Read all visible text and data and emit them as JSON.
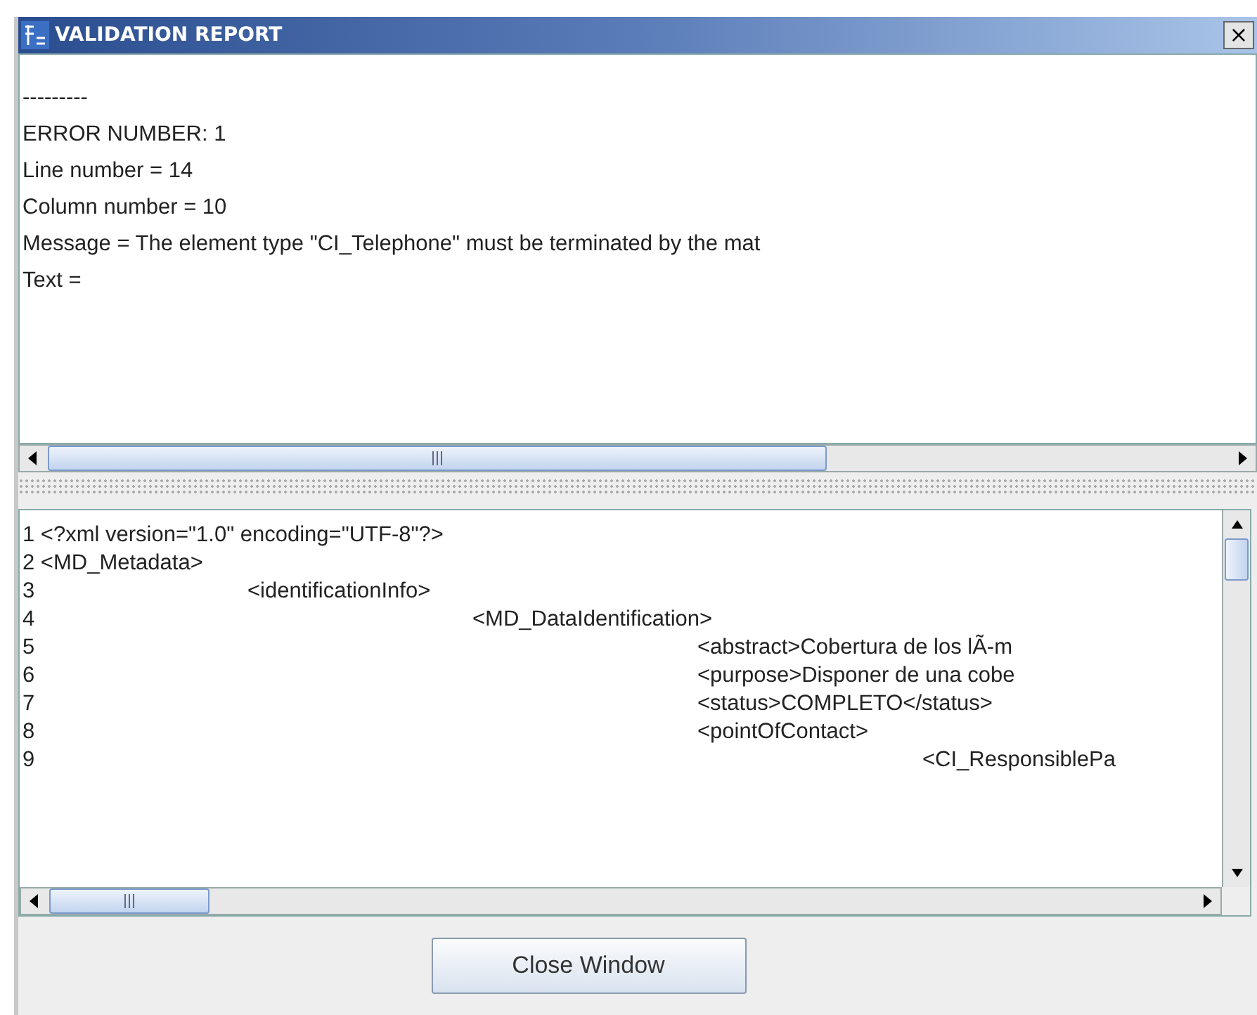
{
  "window": {
    "title": "VALIDATION REPORT",
    "close": "×"
  },
  "report": {
    "lines": [
      "---------",
      "ERROR NUMBER: 1",
      "Line number = 14",
      "Column number = 10",
      "Message = The element type \"CI_Telephone\" must be terminated by the mat",
      "Text ="
    ]
  },
  "source": {
    "lines": [
      "1 <?xml version=\"1.0\" encoding=\"UTF-8\"?>",
      "2 <MD_Metadata>",
      "3 \t<identificationInfo>",
      "4 \t\t<MD_DataIdentification>",
      "5 \t\t\t<abstract>Cobertura de los lÃ-m",
      "6 \t\t\t<purpose>Disponer de una cobe",
      "7 \t\t\t<status>COMPLETO</status>",
      "8 \t\t\t<pointOfContact>",
      "9 \t\t\t\t<CI_ResponsiblePa"
    ]
  },
  "buttons": [
    "Close Window"
  ]
}
